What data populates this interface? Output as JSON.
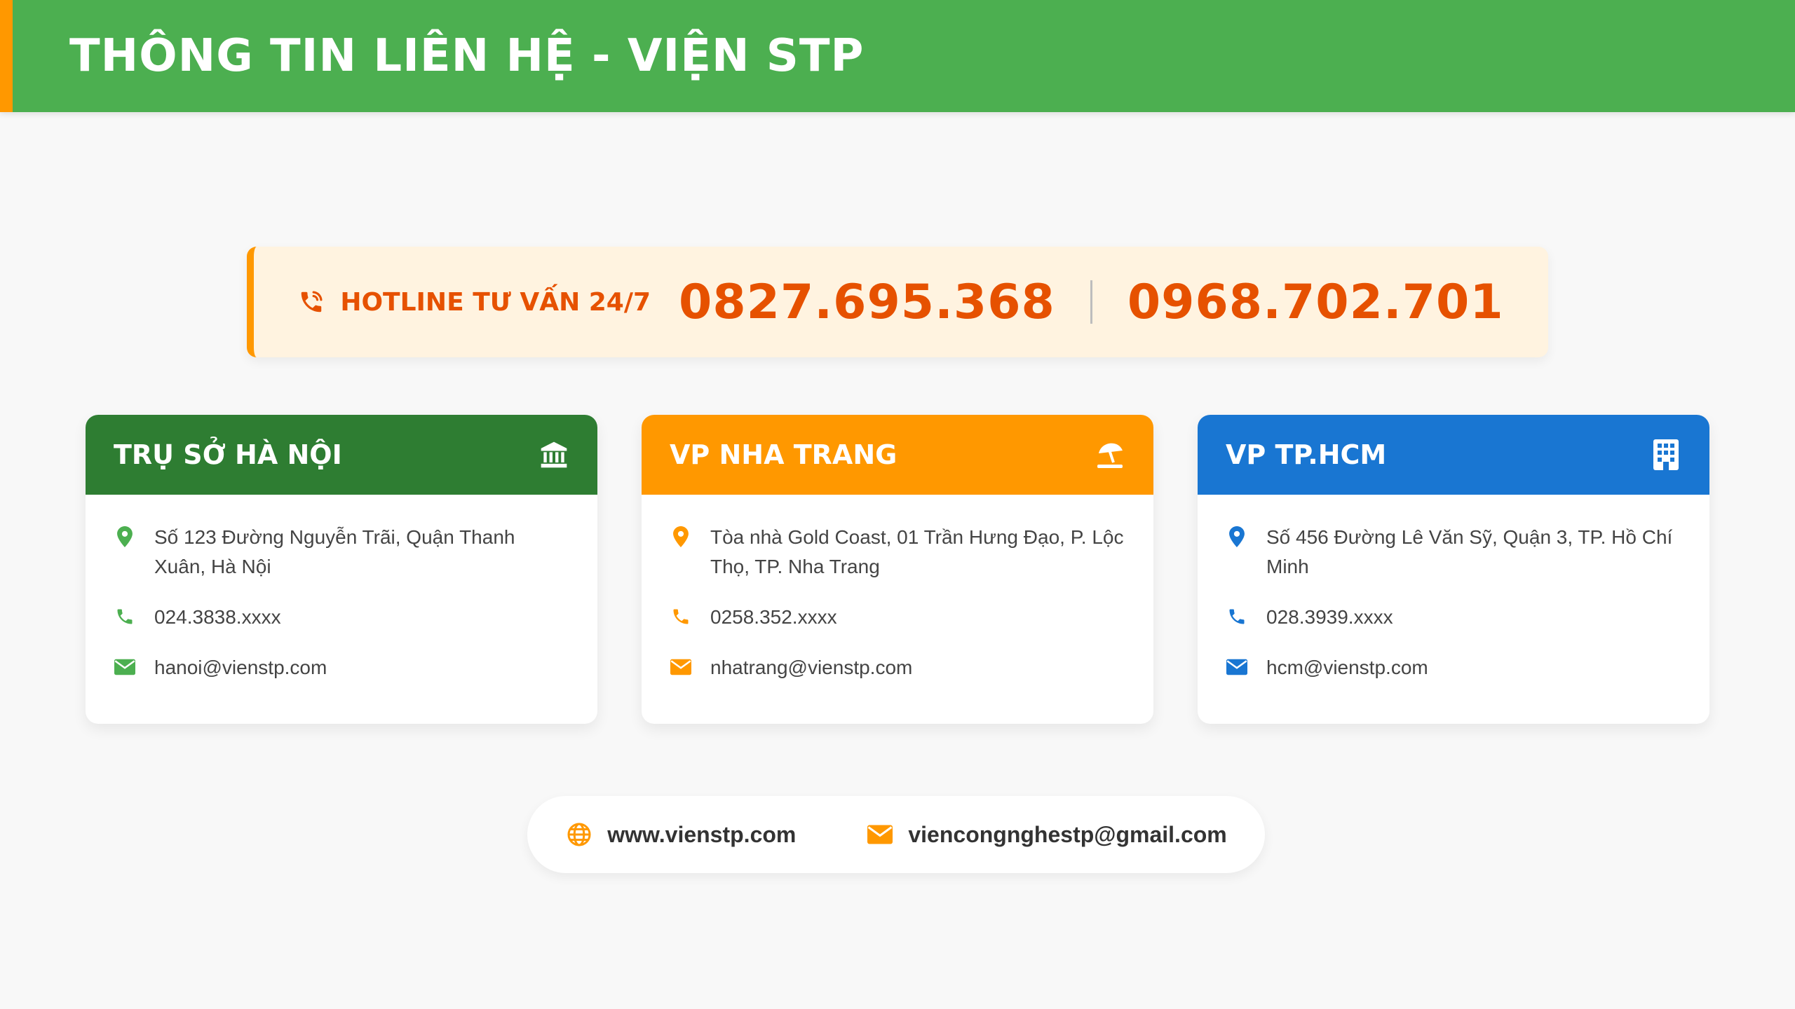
{
  "header": {
    "title": "THÔNG TIN LIÊN HỆ - VIỆN STP"
  },
  "hotline": {
    "label": "HOTLINE TƯ VẤN 24/7",
    "number_1": "0827.695.368",
    "number_2": "0968.702.701",
    "icon": "phone-volume-icon"
  },
  "offices": [
    {
      "title": "TRỤ SỞ HÀ NỘI",
      "icon": "landmark-icon",
      "color": "#2e7d32",
      "address": "Số 123 Đường Nguyễn Trãi, Quận Thanh Xuân, Hà Nội",
      "phone": "024.3838.xxxx",
      "email": "hanoi@vienstp.com"
    },
    {
      "title": "VP NHA TRANG",
      "icon": "umbrella-beach-icon",
      "color": "#ff9800",
      "address": "Tòa nhà Gold Coast, 01 Trần Hưng Đạo, P. Lộc Thọ, TP. Nha Trang",
      "phone": "0258.352.xxxx",
      "email": "nhatrang@vienstp.com"
    },
    {
      "title": "VP TP.HCM",
      "icon": "building-icon",
      "color": "#1976d2",
      "address": "Số 456 Đường Lê Văn Sỹ, Quận 3, TP. Hồ Chí Minh",
      "phone": "028.3939.xxxx",
      "email": "hcm@vienstp.com"
    }
  ],
  "footer": {
    "website": "www.vienstp.com",
    "email": "viencongnghestp@gmail.com"
  },
  "colors": {
    "header_green": "#4caf50",
    "accent_orange": "#ff9800",
    "hotline_text": "#e65100",
    "hotline_bg": "#fff3e0"
  }
}
